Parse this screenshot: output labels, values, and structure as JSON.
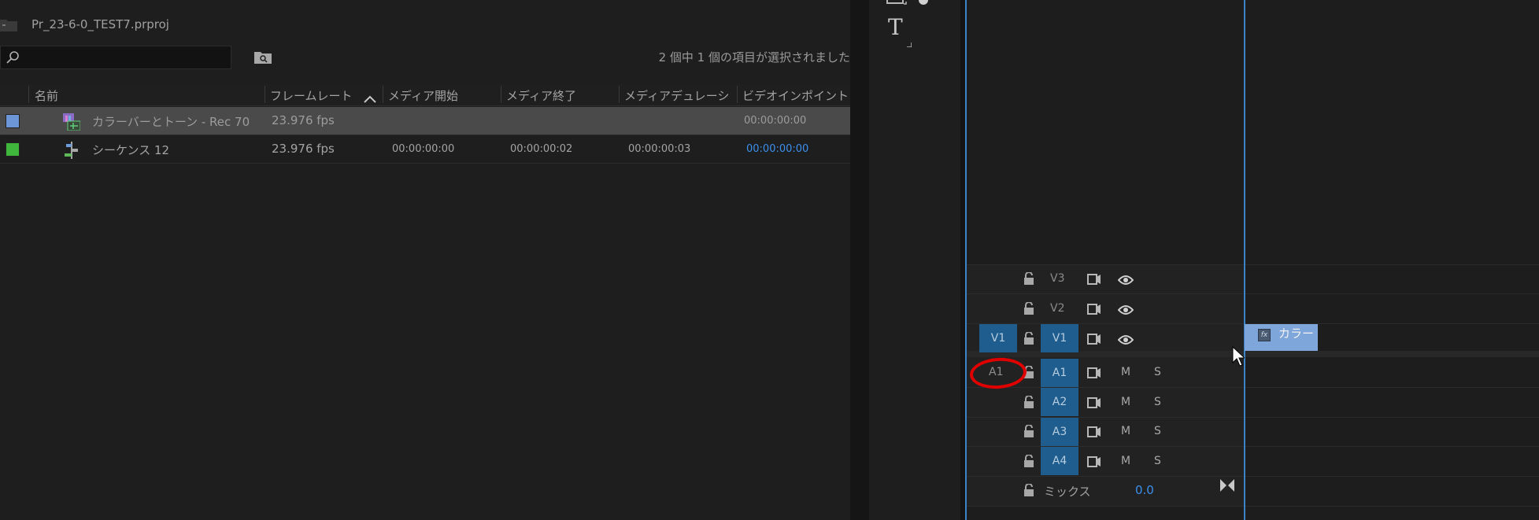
{
  "project": {
    "title": "Pr_23-6-0_TEST7.prproj",
    "status": "2 個中 1 個の項目が選択されました",
    "columns": [
      "名前",
      "フレームレート",
      "メディア開始",
      "メディア終了",
      "メディアデュレーシ",
      "ビデオインポイント"
    ],
    "rows": [
      {
        "name": "カラーバーとトーン - Rec 70",
        "fps": "23.976 fps",
        "start": "",
        "end": "",
        "duration": "",
        "in": "00:00:00:00",
        "color": "#6c96d8",
        "selected": true
      },
      {
        "name": "シーケンス 12",
        "fps": "23.976 fps",
        "start": "00:00:00:00",
        "end": "00:00:00:02",
        "duration": "00:00:00:03",
        "in": "00:00:00:00",
        "color": "#3fb63c",
        "selected": false
      }
    ]
  },
  "tools": {
    "type_tool": "T"
  },
  "timeline": {
    "video_tracks": [
      {
        "label": "V3"
      },
      {
        "label": "V2"
      },
      {
        "label": "V1",
        "source": "V1"
      }
    ],
    "audio_tracks": [
      {
        "label": "A1",
        "source": "A1",
        "m": "M",
        "s": "S"
      },
      {
        "label": "A2",
        "m": "M",
        "s": "S"
      },
      {
        "label": "A3",
        "m": "M",
        "s": "S"
      },
      {
        "label": "A4",
        "m": "M",
        "s": "S"
      }
    ],
    "mix_label": "ミックス",
    "mix_value": "0.0",
    "clip_label": "カラー",
    "fx_badge": "fx"
  },
  "colors": {
    "accent": "#3d83c8",
    "track_blue": "#1e5d8d",
    "clip": "#7fa6db",
    "annotation": "#e10000"
  }
}
